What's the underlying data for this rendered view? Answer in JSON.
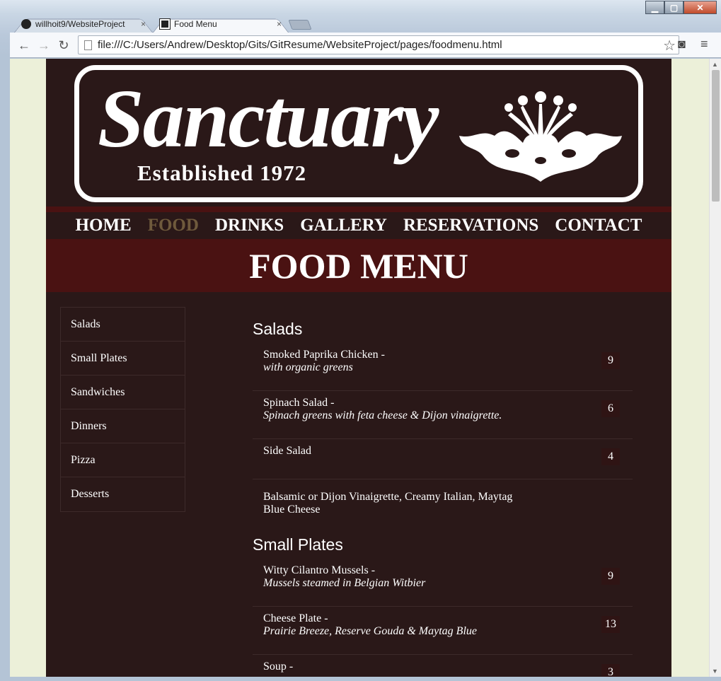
{
  "browser": {
    "tabs": [
      {
        "label": "willhoit9/WebsiteProject",
        "close": "×"
      },
      {
        "label": "Food Menu",
        "close": "×"
      }
    ],
    "url": "file:///C:/Users/Andrew/Desktop/Gits/GitResume/WebsiteProject/pages/foodmenu.html",
    "window_controls": {
      "minimize": "▁",
      "maximize": "▢",
      "close": "✕"
    },
    "nav": {
      "back": "←",
      "forward": "→",
      "reload": "↻",
      "star": "☆",
      "pocket": "◙",
      "menu": "≡"
    }
  },
  "site": {
    "logo": {
      "name": "Sanctuary",
      "established": "Established 1972"
    },
    "nav": [
      {
        "label": "HOME"
      },
      {
        "label": "FOOD"
      },
      {
        "label": "DRINKS"
      },
      {
        "label": "GALLERY"
      },
      {
        "label": "RESERVATIONS"
      },
      {
        "label": "CONTACT"
      }
    ],
    "page_title": "FOOD MENU",
    "side_menu": [
      "Salads",
      "Small Plates",
      "Sandwiches",
      "Dinners",
      "Pizza",
      "Desserts"
    ],
    "categories": [
      {
        "title": "Salads",
        "items": [
          {
            "name": "Smoked Paprika Chicken -",
            "desc": "with organic greens",
            "price": "9"
          },
          {
            "name": "Spinach Salad -",
            "desc": "Spinach greens with feta cheese & Dijon vinaigrette.",
            "price": "6"
          },
          {
            "name": "Side Salad",
            "desc": "",
            "price": "4"
          }
        ],
        "note": "Balsamic or Dijon Vinaigrette, Creamy Italian, Maytag Blue Cheese"
      },
      {
        "title": "Small Plates",
        "items": [
          {
            "name": "Witty Cilantro Mussels -",
            "desc": "Mussels steamed in Belgian Witbier",
            "price": "9"
          },
          {
            "name": "Cheese Plate -",
            "desc": "Prairie Breeze, Reserve Gouda & Maytag Blue",
            "price": "13"
          },
          {
            "name": "Soup -",
            "desc": "",
            "price": "3"
          }
        ]
      }
    ]
  },
  "colors": {
    "site_bg": "#2a1818",
    "accent_red": "#4a1212",
    "nav_current": "#6f5a3c",
    "page_bg": "#ecf0d9"
  }
}
